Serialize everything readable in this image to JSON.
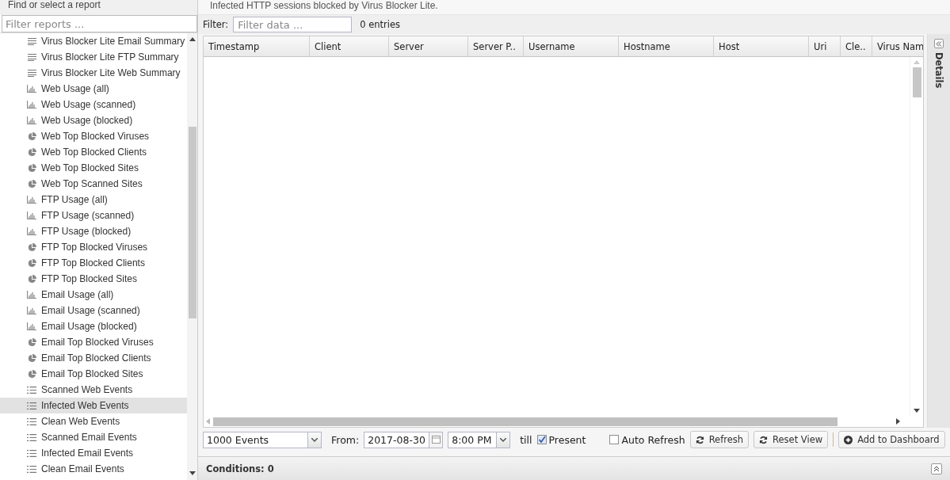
{
  "sidebar": {
    "title": "Find or select a report",
    "filter_placeholder": "Filter reports ...",
    "items": [
      {
        "label": "Virus Blocker Lite Email Summary",
        "kind": "text",
        "selected": false
      },
      {
        "label": "Virus Blocker Lite FTP Summary",
        "kind": "text",
        "selected": false
      },
      {
        "label": "Virus Blocker Lite Web Summary",
        "kind": "text",
        "selected": false
      },
      {
        "label": "Web Usage (all)",
        "kind": "bar",
        "selected": false
      },
      {
        "label": "Web Usage (scanned)",
        "kind": "bar",
        "selected": false
      },
      {
        "label": "Web Usage (blocked)",
        "kind": "bar",
        "selected": false
      },
      {
        "label": "Web Top Blocked Viruses",
        "kind": "pie",
        "selected": false
      },
      {
        "label": "Web Top Blocked Clients",
        "kind": "pie",
        "selected": false
      },
      {
        "label": "Web Top Blocked Sites",
        "kind": "pie",
        "selected": false
      },
      {
        "label": "Web Top Scanned Sites",
        "kind": "pie",
        "selected": false
      },
      {
        "label": "FTP Usage (all)",
        "kind": "bar",
        "selected": false
      },
      {
        "label": "FTP Usage (scanned)",
        "kind": "bar",
        "selected": false
      },
      {
        "label": "FTP Usage (blocked)",
        "kind": "bar",
        "selected": false
      },
      {
        "label": "FTP Top Blocked Viruses",
        "kind": "pie",
        "selected": false
      },
      {
        "label": "FTP Top Blocked Clients",
        "kind": "pie",
        "selected": false
      },
      {
        "label": "FTP Top Blocked Sites",
        "kind": "pie",
        "selected": false
      },
      {
        "label": "Email Usage (all)",
        "kind": "bar",
        "selected": false
      },
      {
        "label": "Email Usage (scanned)",
        "kind": "bar",
        "selected": false
      },
      {
        "label": "Email Usage (blocked)",
        "kind": "bar",
        "selected": false
      },
      {
        "label": "Email Top Blocked Viruses",
        "kind": "pie",
        "selected": false
      },
      {
        "label": "Email Top Blocked Clients",
        "kind": "pie",
        "selected": false
      },
      {
        "label": "Email Top Blocked Sites",
        "kind": "pie",
        "selected": false
      },
      {
        "label": "Scanned Web Events",
        "kind": "list",
        "selected": false
      },
      {
        "label": "Infected Web Events",
        "kind": "list",
        "selected": true
      },
      {
        "label": "Clean Web Events",
        "kind": "list",
        "selected": false
      },
      {
        "label": "Scanned Email Events",
        "kind": "list",
        "selected": false
      },
      {
        "label": "Infected Email Events",
        "kind": "list",
        "selected": false
      },
      {
        "label": "Clean Email Events",
        "kind": "list",
        "selected": false
      }
    ]
  },
  "description": "Infected HTTP sessions blocked by Virus Blocker Lite.",
  "filter": {
    "label": "Filter:",
    "placeholder": "Filter data ...",
    "count": "0 entries"
  },
  "table": {
    "columns": [
      "Timestamp",
      "Client",
      "Server",
      "Server P..",
      "Username",
      "Hostname",
      "Host",
      "Uri",
      "Cle..",
      "Virus Nam"
    ]
  },
  "toolbar": {
    "limit": "1000 Events",
    "from_label": "From:",
    "date": "2017-08-30",
    "time": "8:00 PM",
    "till_label": "till",
    "present": {
      "label": "Present",
      "checked": true
    },
    "auto_refresh": {
      "label": "Auto Refresh",
      "checked": false
    },
    "buttons": [
      {
        "label": "Refresh",
        "kind": "refresh"
      },
      {
        "label": "Reset View",
        "kind": "refresh"
      },
      {
        "label": "Add to Dashboard",
        "kind": "add"
      }
    ]
  },
  "conditions": "Conditions: 0",
  "details_panel": {
    "title": "Details"
  }
}
